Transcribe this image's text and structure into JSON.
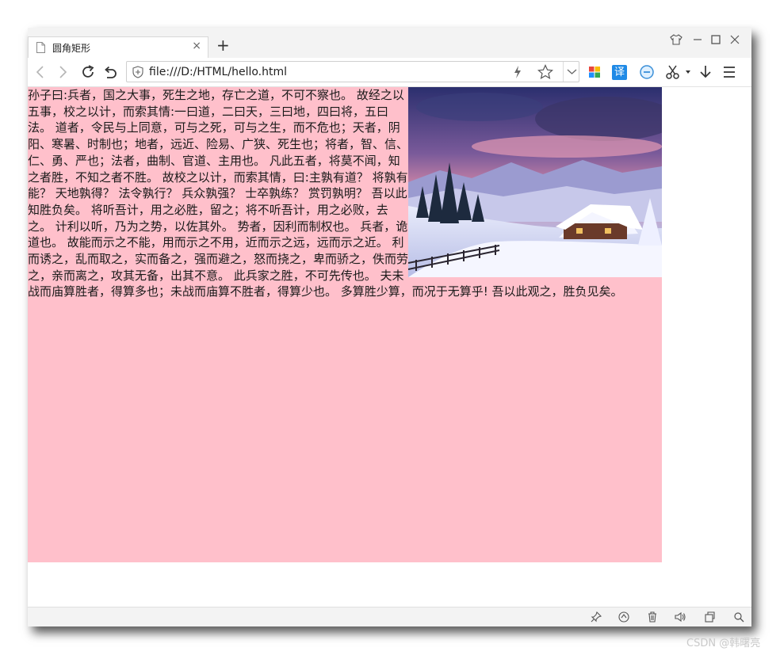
{
  "tab": {
    "title": "圆角矩形",
    "close": "×"
  },
  "new_tab": "+",
  "address": {
    "url": "file:///D:/HTML/hello.html"
  },
  "toolbar": {
    "translate_label": "译"
  },
  "content": {
    "text": "孙子曰:兵者，国之大事，死生之地，存亡之道，不可不察也。 故经之以五事，校之以计，而索其情:一曰道，二曰天，三曰地，四曰将，五曰法。 道者，令民与上同意，可与之死，可与之生，而不危也；天者，阴阳、寒暑、时制也；地者，远近、险易、广狭、死生也；将者，智、信、仁、勇、严也；法者，曲制、官道、主用也。 凡此五者，将莫不闻，知之者胜，不知之者不胜。 故校之以计，而索其情，曰:主孰有道？ 将孰有能？ 天地孰得？ 法令孰行？ 兵众孰强？ 士卒孰练？ 赏罚孰明？ 吾以此知胜负矣。 将听吾计，用之必胜，留之；将不听吾计，用之必败，去之。 计利以听，乃为之势，以佐其外。 势者，因利而制权也。 兵者，诡道也。 故能而示之不能，用而示之不用，近而示之远，远而示之近。 利而诱之，乱而取之，实而备之，强而避之，怒而挠之，卑而骄之，佚而劳之，亲而离之，攻其无备，出其不意。 此兵家之胜，不可先传也。 夫未战而庙算胜者，得算多也；未战而庙算不胜者，得算少也。 多算胜少算，而况于无算乎! 吾以此观之，胜负见矣。",
    "background": "#ffc0cb"
  },
  "watermark": "CSDN @韩曙亮"
}
